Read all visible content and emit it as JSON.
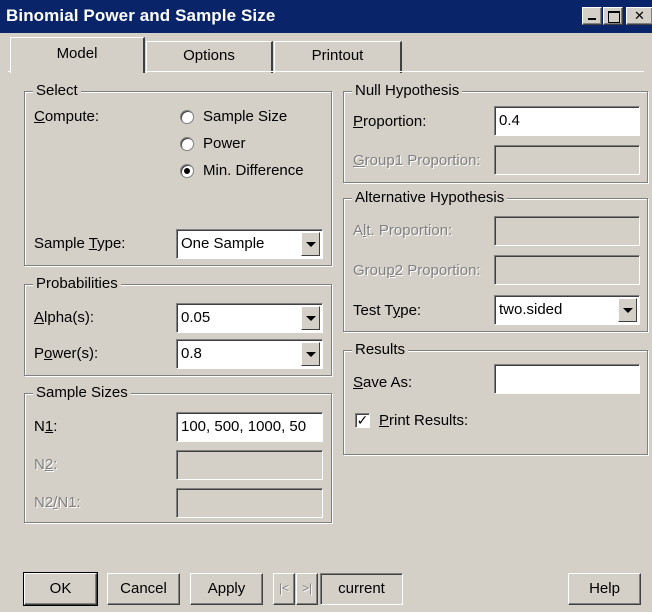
{
  "window": {
    "title": "Binomial Power and Sample Size",
    "minimize_glyph": "",
    "maximize_glyph": "",
    "close_glyph": "✕"
  },
  "tabs": [
    {
      "label": "Model"
    },
    {
      "label": "Options"
    },
    {
      "label": "Printout"
    }
  ],
  "select": {
    "group_label": "Select",
    "compute_label": "Compute:",
    "compute_options": [
      {
        "label": "Sample Size",
        "selected": false
      },
      {
        "label": "Power",
        "selected": false
      },
      {
        "label": "Min. Difference",
        "selected": true
      }
    ],
    "sample_type_label": "Sample Type:",
    "sample_type_value": "One Sample"
  },
  "probabilities": {
    "group_label": "Probabilities",
    "alpha_label": "Alpha(s):",
    "alpha_value": "0.05",
    "power_label": "Power(s):",
    "power_value": "0.8"
  },
  "sample_sizes": {
    "group_label": "Sample Sizes",
    "n1_label": "N1:",
    "n1_value": "100, 500, 1000, 50",
    "n2_label": "N2:",
    "n2_value": "",
    "n2n1_label": "N2/N1:",
    "n2n1_value": ""
  },
  "null_hypothesis": {
    "group_label": "Null Hypothesis",
    "proportion_label": "Proportion:",
    "proportion_value": "0.4",
    "group1_label": "Group1 Proportion:",
    "group1_value": ""
  },
  "alternative_hypothesis": {
    "group_label": "Alternative Hypothesis",
    "alt_label": "Alt. Proportion:",
    "alt_value": "",
    "group2_label": "Group2 Proportion:",
    "group2_value": "",
    "test_type_label": "Test Type:",
    "test_type_value": "two.sided"
  },
  "results": {
    "group_label": "Results",
    "save_as_label": "Save As:",
    "save_as_value": "",
    "print_label": "Print Results:",
    "print_checked": true
  },
  "buttons": {
    "ok": "OK",
    "cancel": "Cancel",
    "apply": "Apply",
    "prev": "|<",
    "next": ">|",
    "current": "current",
    "help": "Help"
  }
}
